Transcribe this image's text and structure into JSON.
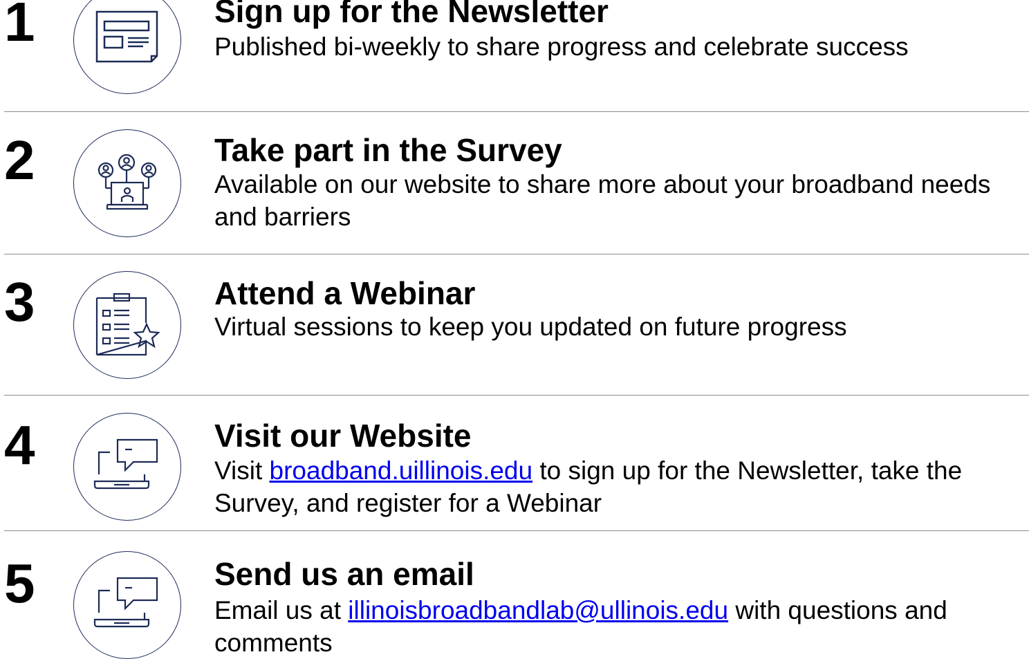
{
  "colors": {
    "icon_stroke": "#1b2a56",
    "divider": "#8c8c8c",
    "link": "#0000ee",
    "text": "#000000"
  },
  "steps": [
    {
      "number": "1",
      "icon": "newsletter-icon",
      "title": "Sign up for the Newsletter",
      "description": "Published bi-weekly to share progress and celebrate success"
    },
    {
      "number": "2",
      "icon": "survey-people-icon",
      "title": "Take part in the Survey",
      "description": "Available on our website to share more about your broadband needs and barriers"
    },
    {
      "number": "3",
      "icon": "checklist-star-icon",
      "title": "Attend a Webinar",
      "description": "Virtual sessions to keep you updated on future progress"
    },
    {
      "number": "4",
      "icon": "laptop-chat-icon",
      "title": "Visit our Website",
      "description_before": "Visit ",
      "link": "broadband.uillinois.edu",
      "description_after": " to sign up for the Newsletter, take the Survey, and register for a Webinar"
    },
    {
      "number": "5",
      "icon": "laptop-chat-icon",
      "title": "Send us an email",
      "description_before": "Email us at ",
      "link": "illinoisbroadbandlab@ullinois.edu",
      "description_after": " with questions and comments"
    }
  ]
}
